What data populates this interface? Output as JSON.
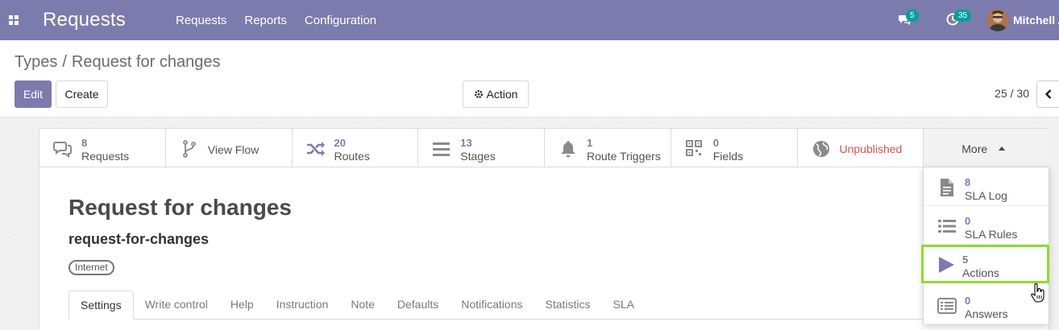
{
  "navbar": {
    "brand": "Requests",
    "menu": [
      "Requests",
      "Reports",
      "Configuration"
    ],
    "chat_count": "5",
    "activity_count": "35",
    "user_name": "Mitchell A",
    "bg_color": "#7c7bad"
  },
  "control": {
    "breadcrumb_parent": "Types",
    "breadcrumb_sep": "/",
    "breadcrumb_current": "Request for changes",
    "edit_label": "Edit",
    "create_label": "Create",
    "action_label": "Action",
    "pager": "25 / 30"
  },
  "smart_buttons": [
    {
      "icon": "comments-icon",
      "value": "8",
      "label": "Requests"
    },
    {
      "icon": "flow-icon",
      "value": "",
      "label": "View Flow"
    },
    {
      "icon": "random-icon",
      "value": "20",
      "label": "Routes"
    },
    {
      "icon": "bars-icon",
      "value": "13",
      "label": "Stages"
    },
    {
      "icon": "bell-icon",
      "value": "1",
      "label": "Route Triggers"
    },
    {
      "icon": "qrcode-icon",
      "value": "0",
      "label": "Fields"
    },
    {
      "icon": "globe-icon",
      "value": "",
      "label": "Unpublished"
    }
  ],
  "more_label": "More",
  "dropdown_items": [
    {
      "icon": "file-icon",
      "value": "8",
      "label": "SLA Log"
    },
    {
      "icon": "list-icon",
      "value": "0",
      "label": "SLA Rules"
    },
    {
      "icon": "play-icon",
      "value": "5",
      "label": "Actions"
    },
    {
      "icon": "list-alt-icon",
      "value": "0",
      "label": "Answers"
    }
  ],
  "record": {
    "title": "Request for changes",
    "code": "request-for-changes",
    "tag": "Internet"
  },
  "tabs": [
    "Settings",
    "Write control",
    "Help",
    "Instruction",
    "Note",
    "Defaults",
    "Notifications",
    "Statistics",
    "SLA"
  ],
  "colors": {
    "accent": "#7c7bad",
    "highlight": "#8fdc2f",
    "danger": "#d9534f"
  }
}
